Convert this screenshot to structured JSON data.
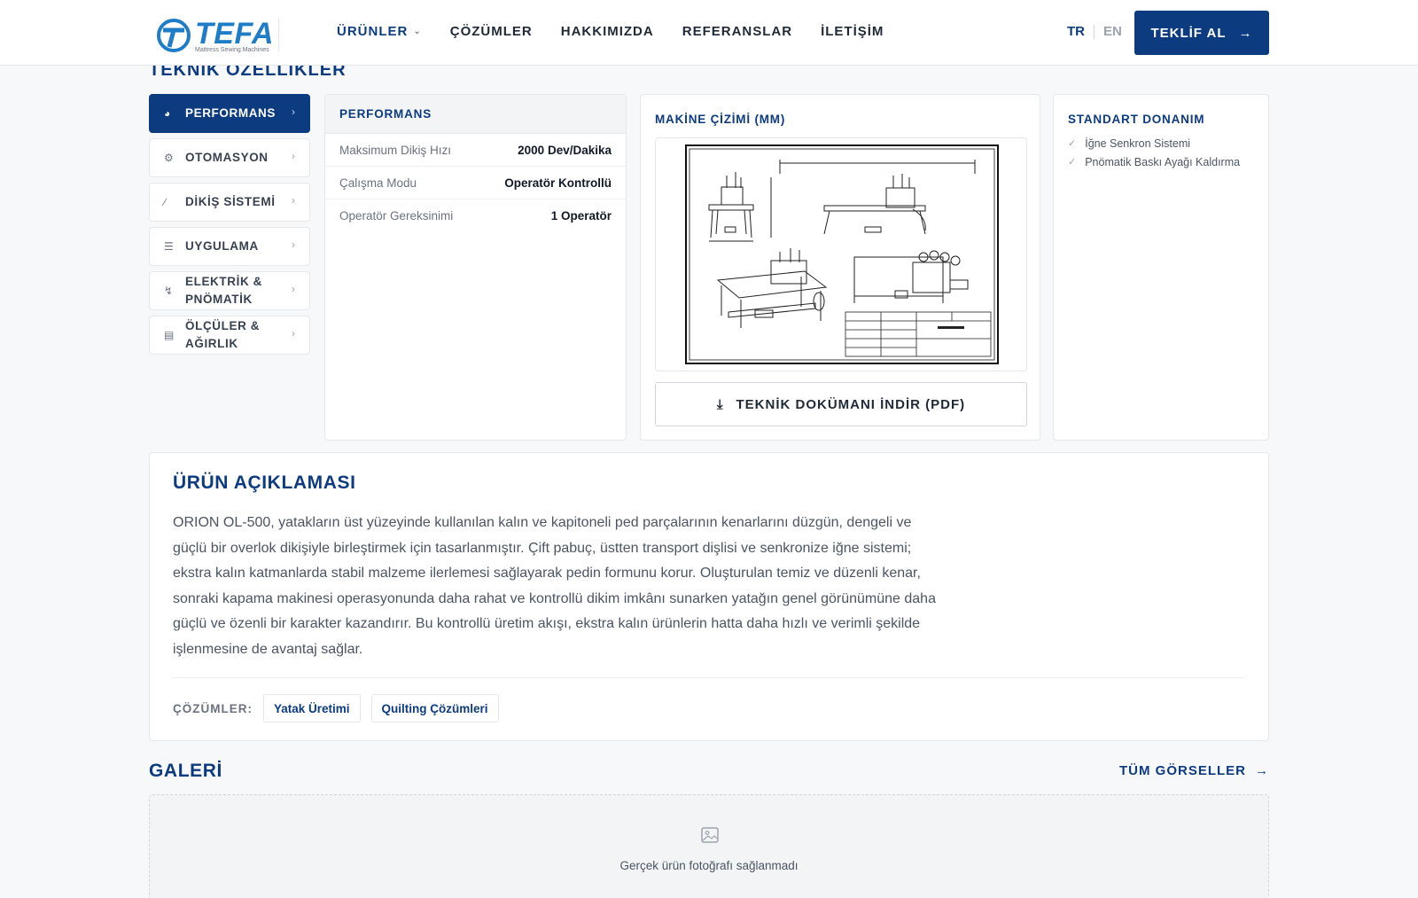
{
  "header": {
    "logo_text": "TEFA",
    "logo_sub": "Mattress Sewing Machines",
    "nav": [
      {
        "label": "ÜRÜNLER"
      },
      {
        "label": "ÇÖZÜMLER"
      },
      {
        "label": "HAKKIMIZDA"
      },
      {
        "label": "REFERANSLAR"
      },
      {
        "label": "İLETİŞİM"
      }
    ],
    "lang_tr": "TR",
    "lang_en": "EN",
    "quote_button": "TEKLİF AL"
  },
  "section_title": "TEKNİK ÖZELLİKLER",
  "tabs": [
    {
      "label": "PERFORMANS",
      "icon": "gauge-icon"
    },
    {
      "label": "OTOMASYON",
      "icon": "cog-icon"
    },
    {
      "label": "DİKİŞ SİSTEMİ",
      "icon": "needle-icon"
    },
    {
      "label": "UYGULAMA",
      "icon": "layers-icon"
    },
    {
      "label": "ELEKTRİK & PNÖMATİK",
      "icon": "bolt-icon"
    },
    {
      "label": "ÖLÇÜLER & AĞIRLIK",
      "icon": "ruler-icon"
    }
  ],
  "performance": {
    "title": "PERFORMANS",
    "rows": [
      {
        "key": "Maksimum Dikiş Hızı",
        "value": "2000 Dev/Dakika"
      },
      {
        "key": "Çalışma Modu",
        "value": "Operatör Kontrollü"
      },
      {
        "key": "Operatör Gereksinimi",
        "value": "1 Operatör"
      }
    ]
  },
  "drawing": {
    "title": "MAKİNE ÇİZİMİ (MM)",
    "download_button": "TEKNİK DOKÜMANI İNDİR (PDF)"
  },
  "standard": {
    "title": "STANDART DONANIM",
    "items": [
      "İğne Senkron Sistemi",
      "Pnömatik Baskı Ayağı Kaldırma"
    ]
  },
  "description": {
    "title": "ÜRÜN AÇIKLAMASI",
    "text": "ORION OL-500, yatakların üst yüzeyinde kullanılan kalın ve kapitoneli ped parçalarının kenarlarını düzgün, dengeli ve güçlü bir overlok dikişiyle birleştirmek için tasarlanmıştır. Çift pabuç, üstten transport dişlisi ve senkronize iğne sistemi; ekstra kalın katmanlarda stabil malzeme ilerlemesi sağlayarak pedin formunu korur. Oluşturulan temiz ve düzenli kenar, sonraki kapama makinesi operasyonunda daha rahat ve kontrollü dikim imkânı sunarken yatağın genel görünümüne daha güçlü ve özenli bir karakter kazandırır. Bu kontrollü üretim akışı, ekstra kalın ürünlerin hatta daha hızlı ve verimli şekilde işlenmesine de avantaj sağlar.",
    "solutions_label": "ÇÖZÜMLER:",
    "solutions": [
      "Yatak Üretimi",
      "Quilting Çözümleri"
    ]
  },
  "gallery": {
    "title": "GALERİ",
    "all_link": "TÜM GÖRSELLER",
    "empty_note": "Gerçek ürün fotoğrafı sağlanmadı"
  },
  "colors": {
    "brand": "#0d3b80",
    "logo": "#1f7dc8"
  }
}
